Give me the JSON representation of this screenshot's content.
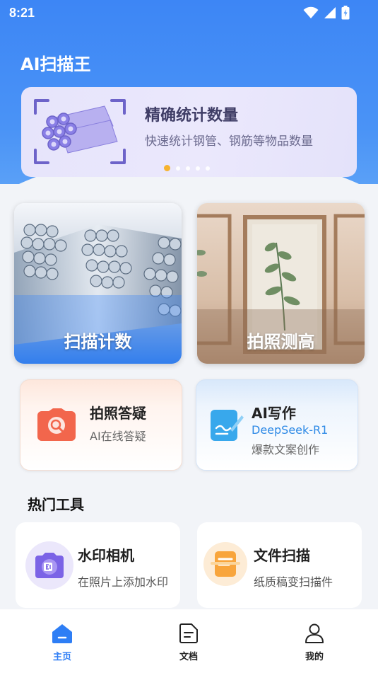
{
  "status_bar": {
    "time": "8:21"
  },
  "app_title": "AI扫描王",
  "banner": {
    "title": "精确统计数量",
    "subtitle": "快速统计钢管、钢筋等物品数量",
    "dot_count": 5,
    "active_dot": 0
  },
  "feature_cards": [
    {
      "label": "扫描计数"
    },
    {
      "label": "拍照测高"
    }
  ],
  "mid_cards": {
    "qa": {
      "title": "拍照答疑",
      "subtitle": "AI在线答疑"
    },
    "write": {
      "title": "AI写作",
      "model": "DeepSeek-R1",
      "subtitle": "爆款文案创作"
    }
  },
  "hot_tools": {
    "section_title": "热门工具",
    "items": [
      {
        "title": "水印相机",
        "subtitle": "在照片上添加水印"
      },
      {
        "title": "文件扫描",
        "subtitle": "纸质稿变扫描件"
      }
    ]
  },
  "tabbar": [
    {
      "label": "主页",
      "active": true
    },
    {
      "label": "文档",
      "active": false
    },
    {
      "label": "我的",
      "active": false
    }
  ],
  "colors": {
    "primary": "#2e7ef5",
    "accent_dot": "#f6b32f"
  }
}
